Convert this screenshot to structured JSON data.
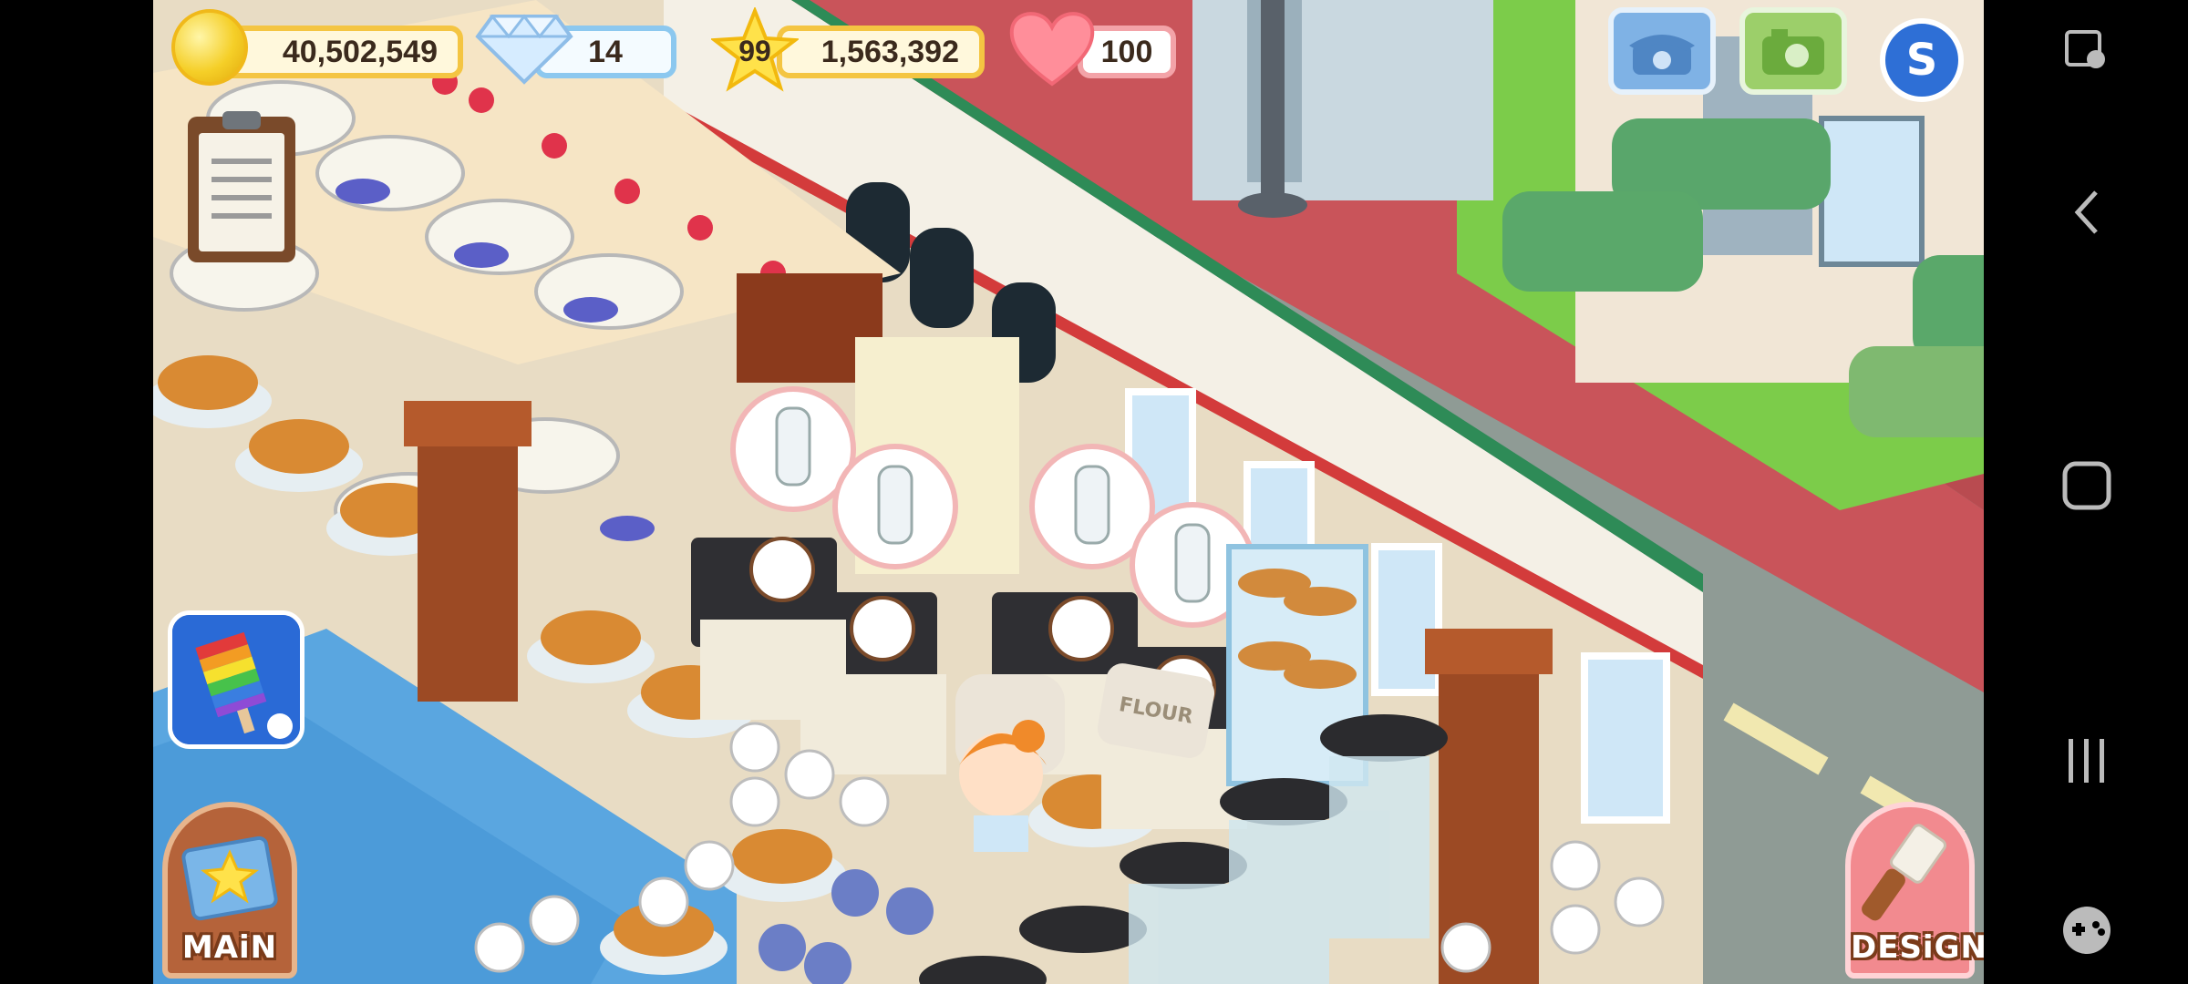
{
  "hud": {
    "coins": "40,502,549",
    "gems": "14",
    "level": "99",
    "xp": "1,563,392",
    "hearts": "100"
  },
  "buttons": {
    "main_label": "MAiN",
    "design_label": "DESiGN",
    "sack_label": "FLOUR"
  },
  "icons": {
    "coin": "coin-icon",
    "gem": "diamond-icon",
    "star": "star-icon",
    "heart": "heart-icon",
    "phone": "phone-icon",
    "camera": "camera-icon",
    "social": "social-s-icon",
    "clipboard": "clipboard-icon",
    "promo": "rainbow-popsicle-icon"
  },
  "colors": {
    "coin_border": "#f4c542",
    "gem_border": "#8cc8ef",
    "heart_border": "#f3a3a8",
    "button_blue": "#7fb2e5",
    "button_green": "#9ccf6a",
    "street": "#8f9b95",
    "brick": "#c9545a"
  },
  "system_nav": {
    "game_tools": "game-tools-icon",
    "back": "back-icon",
    "home": "home-icon",
    "recents": "recents-icon",
    "game_launcher": "game-launcher-icon"
  }
}
